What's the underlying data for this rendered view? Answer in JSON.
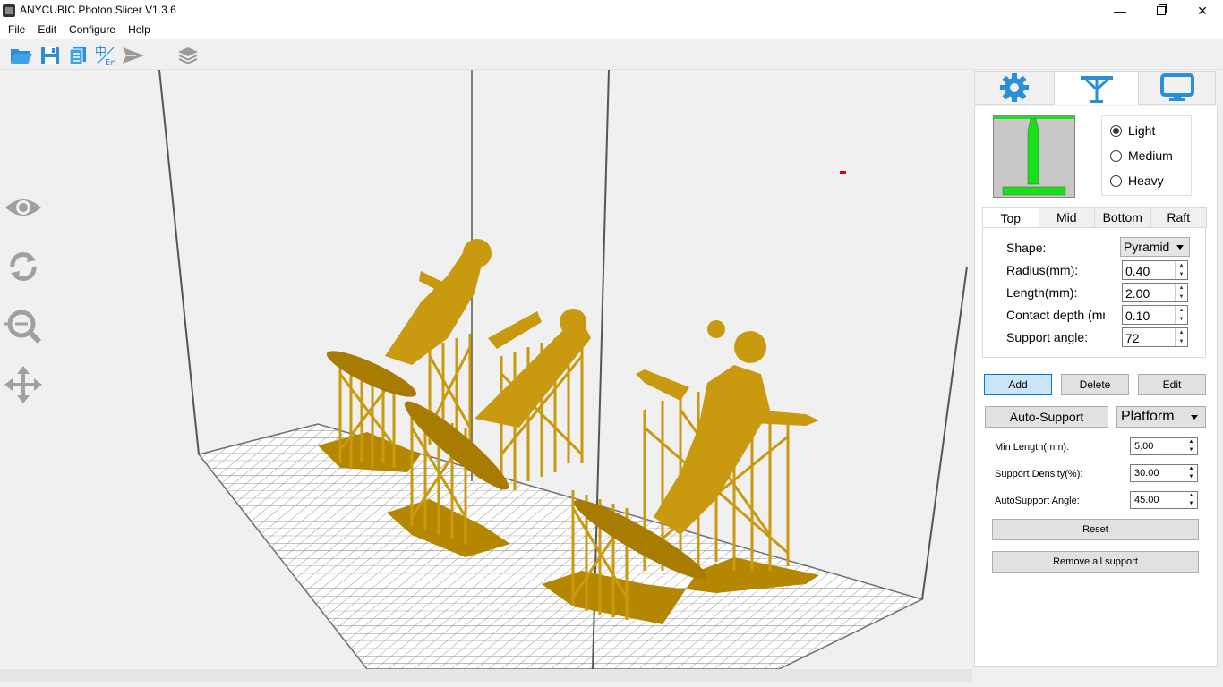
{
  "window": {
    "title": "ANYCUBIC Photon Slicer V1.3.6",
    "minimize_glyph": "—",
    "close_glyph": "✕"
  },
  "menu": {
    "items": [
      "File",
      "Edit",
      "Configure",
      "Help"
    ]
  },
  "toolbar": {
    "icons": [
      "open-folder-icon",
      "save-icon",
      "copy-icon",
      "language-icon",
      "send-icon",
      "layers-icon"
    ]
  },
  "side_tools": {
    "icons": [
      "eye-icon",
      "rotate-icon",
      "zoom-icon",
      "move-icon"
    ]
  },
  "panel": {
    "tabs": [
      "gear-icon",
      "support-icon",
      "monitor-icon"
    ],
    "active_tab": 1,
    "support_strength": {
      "options": [
        "Light",
        "Medium",
        "Heavy"
      ],
      "selected": "Light"
    },
    "subtabs": [
      "Top",
      "Mid",
      "Bottom",
      "Raft"
    ],
    "active_subtab": "Top",
    "fields": {
      "shape_label": "Shape:",
      "shape_value": "Pyramid",
      "radius_label": "Radius(mm):",
      "radius_value": "0.40",
      "length_label": "Length(mm):",
      "length_value": "2.00",
      "contact_label": "Contact depth (mm):",
      "contact_value": "0.10",
      "angle_label": "Support angle:",
      "angle_value": "72"
    },
    "actions": {
      "add": "Add",
      "delete": "Delete",
      "edit": "Edit"
    },
    "auto_support": {
      "button": "Auto-Support",
      "mode": "Platform",
      "min_length_label": "Min Length(mm):",
      "min_length_value": "5.00",
      "density_label": "Support Density(%):",
      "density_value": "30.00",
      "angle_label": "AutoSupport Angle:",
      "angle_value": "45.00",
      "reset": "Reset",
      "remove_all": "Remove all support"
    }
  },
  "colors": {
    "accent": "#2b8fd8",
    "model": "#c9990f",
    "support_preview": "#19e119",
    "grid": "#7a7a7a"
  }
}
